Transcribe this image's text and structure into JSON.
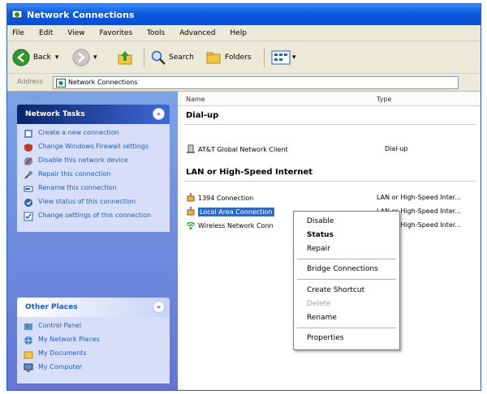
{
  "window": {
    "title": "Network Connections"
  },
  "menu": [
    "File",
    "Edit",
    "View",
    "Favorites",
    "Tools",
    "Advanced",
    "Help"
  ],
  "toolbar": {
    "back_label": "Back",
    "search_label": "Search",
    "folders_label": "Folders"
  },
  "address": {
    "label": "Address",
    "value": "Network Connections"
  },
  "network_tasks": {
    "title": "Network Tasks",
    "items": [
      "Create a new connection",
      "Change Windows Firewall settings",
      "Disable this network device",
      "Repair this connection",
      "Rename this connection",
      "View status of this connection",
      "Change settings of this connection"
    ]
  },
  "other_places": {
    "title": "Other Places",
    "items": [
      "Control Panel",
      "My Network Places",
      "My Documents",
      "My Computer"
    ]
  },
  "columns": {
    "name": "Name",
    "type": "Type"
  },
  "groups": {
    "dialup": "Dial-up",
    "lan": "LAN or High-Speed Internet"
  },
  "connections": [
    {
      "name": "AT&T Global Network Client",
      "type": "Dial-up"
    },
    {
      "name": "1394 Connection",
      "type": "LAN or High-Speed Inter..."
    },
    {
      "name": "Local Area Connection",
      "type": "LAN or High-Speed Inter..."
    },
    {
      "name": "Wireless Network Conn",
      "type": "LAN or High-Speed Inter..."
    }
  ],
  "context_menu": {
    "items": [
      "Disable",
      "Status",
      "Repair",
      "Bridge Connections",
      "Create Shortcut",
      "Delete",
      "Rename",
      "Properties"
    ]
  },
  "colors": {
    "title_blue": "#0b5ae0",
    "task_blue": "#215dc6",
    "selection": "#316ac5",
    "pane_blue": "#6f8edb"
  }
}
